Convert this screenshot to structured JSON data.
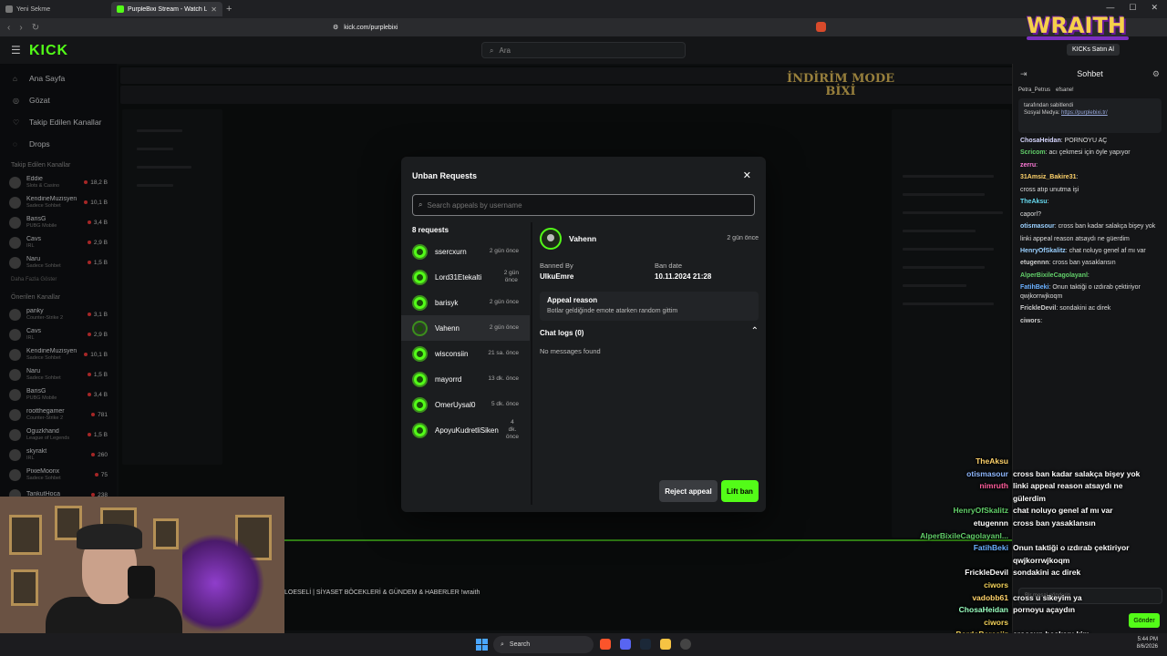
{
  "browser": {
    "tabs": [
      {
        "title": "Yeni Sekme",
        "active": false
      },
      {
        "title": "PurpleBixi Stream - Watch Live o",
        "active": true
      }
    ],
    "url": "kick.com/purplebixi"
  },
  "kick": {
    "logo": "KICK",
    "search_placeholder": "Ara",
    "kicks_button": "KICKs Satın Al",
    "nav": [
      {
        "label": "Ana Sayfa",
        "icon": "home-icon"
      },
      {
        "label": "Gözat",
        "icon": "compass-icon"
      },
      {
        "label": "Takip Edilen Kanallar",
        "icon": "heart-icon"
      },
      {
        "label": "Drops",
        "icon": "drops-icon"
      }
    ],
    "followed_title": "Takip Edilen Kanallar",
    "followed": [
      {
        "name": "Eddie",
        "cat": "Slots & Casino",
        "count": "18,2 B"
      },
      {
        "name": "KendineMuzisyen",
        "cat": "Sadece Sohbet",
        "count": "10,1 B"
      },
      {
        "name": "BarisG",
        "cat": "PUBG Mobile",
        "count": "3,4 B"
      },
      {
        "name": "Cavs",
        "cat": "IRL",
        "count": "2,9 B"
      },
      {
        "name": "Naru",
        "cat": "Sadece Sohbet",
        "count": "1,5 B"
      }
    ],
    "more_label": "Daha Fazla Göster",
    "recommended_title": "Önerilen Kanallar",
    "recommended": [
      {
        "name": "panky",
        "cat": "Counter-Strike 2",
        "count": "3,1 B"
      },
      {
        "name": "Cavs",
        "cat": "IRL",
        "count": "2,9 B"
      },
      {
        "name": "KendineMuzisyen",
        "cat": "Sadece Sohbet",
        "count": "10,1 B"
      },
      {
        "name": "Naru",
        "cat": "Sadece Sohbet",
        "count": "1,5 B"
      },
      {
        "name": "BarisG",
        "cat": "PUBG Mobile",
        "count": "3,4 B"
      },
      {
        "name": "rootthegamer",
        "cat": "Counter-Strike 2",
        "count": "781"
      },
      {
        "name": "Oguzkhand",
        "cat": "League of Legends",
        "count": "1,5 B"
      },
      {
        "name": "skyrakt",
        "cat": "IRL",
        "count": "260"
      },
      {
        "name": "PixieMoonx",
        "cat": "Sadece Sohbet",
        "count": "75"
      },
      {
        "name": "TankutHoca",
        "cat": "",
        "count": "238"
      }
    ]
  },
  "chat": {
    "title": "Sohbet",
    "gifts": [
      "Petra_Petrus",
      "efsane!"
    ],
    "pinned_line1": "tarafından sabitlendi",
    "pinned_line2": "Sosyal Medya:",
    "pinned_link": "https://purplebixi.tr/",
    "messages": [
      {
        "user": "ChosaHeidan",
        "text": "PORNOYU AÇ",
        "color": "#d7d7ff"
      },
      {
        "user": "Scricom",
        "text": "acı çekmesi için öyle yapıyor",
        "color": "#62d06a"
      },
      {
        "user": "zerru",
        "text": "",
        "color": "#ff7ad9"
      },
      {
        "user": "31Amsiz_Bakire31",
        "text": "",
        "color": "#ffd36b"
      },
      {
        "user": "",
        "text": "cross atıp unutma işi",
        "color": "#ff5e5e"
      },
      {
        "user": "TheAksu",
        "text": "",
        "color": "#66d9ef"
      },
      {
        "user": "",
        "text": "caporl?",
        "color": "#aaa"
      },
      {
        "user": "otismasour",
        "text": "cross ban kadar salakça bişey yok",
        "color": "#9ad0ff"
      },
      {
        "user": "",
        "text": "linki appeal reason atsaydı ne güerdim",
        "color": "#ff5e5e"
      },
      {
        "user": "HenryOfSkalitz",
        "text": "chat noluyo genel af mı var",
        "color": "#9ad0ff"
      },
      {
        "user": "etugennn",
        "text": "cross ban yasaklansın",
        "color": "#ccc"
      },
      {
        "user": "AlperBixileCagolayanl",
        "text": "",
        "color": "#62d06a"
      },
      {
        "user": "FatihBeki",
        "text": "Onun taktiği o ızdırab çektiriyor qwjkorrwjkoqm",
        "color": "#6ab0ff"
      },
      {
        "user": "FrickleDevil",
        "text": "sondakini ac direk",
        "color": "#ccc"
      },
      {
        "user": "ciwors",
        "text": "",
        "color": "#ccc"
      }
    ],
    "input_placeholder": "Bir mesaj gönderin",
    "send_label": "Gönder"
  },
  "overlay": {
    "banner": "İNDİRİM MODE BİXİ",
    "brand": "WRAITH",
    "stream_title": "LOESELİ | SİYASET BÖCEKLERİ & GÜNDEM & HABERLER !wraith",
    "chat": [
      {
        "user": "TheAksu",
        "text": "",
        "color": "#ffd36b"
      },
      {
        "user": "otismasour",
        "text": "cross ban kadar salakça bişey yok",
        "color": "#8fb8ff"
      },
      {
        "user": "nimruth",
        "text": "linki appeal reason atsaydı ne",
        "color": "#ff5e9c"
      },
      {
        "user": "",
        "text": "gülerdim",
        "color": "#fff"
      },
      {
        "user": "HenryOfSkalitz",
        "text": "chat noluyo genel af mı var",
        "color": "#62d06a"
      },
      {
        "user": "etugennn",
        "text": "cross ban yasaklansın",
        "color": "#ffffff"
      },
      {
        "user": "AlperBixileCagolayanl...",
        "text": "",
        "color": "#62d06a"
      },
      {
        "user": "FatihBeki",
        "text": "Onun taktiği o ızdırab çektiriyor",
        "color": "#6ab0ff"
      },
      {
        "user": "",
        "text": "qwjkorrwjkoqm",
        "color": "#fff"
      },
      {
        "user": "FrickleDevil",
        "text": "sondakini ac direk",
        "color": "#ffffff"
      },
      {
        "user": "ciwors",
        "text": "",
        "color": "#f2d25a"
      },
      {
        "user": "vadobb61",
        "text": "cross u sikeyim ya",
        "color": "#ffd36b"
      },
      {
        "user": "ChosaHeidan",
        "text": "pornoyu açaydın",
        "color": "#9affc0"
      },
      {
        "user": "ciwors",
        "text": "",
        "color": "#f2d25a"
      },
      {
        "user": "BordoBeresiiz",
        "text": "crossun başkanı kim",
        "color": "#f2d25a"
      }
    ]
  },
  "modal": {
    "title": "Unban Requests",
    "search_placeholder": "Search appeals by username",
    "count_label": "8 requests",
    "requests": [
      {
        "name": "ssercxurn",
        "time": "2 gün önce"
      },
      {
        "name": "Lord31Etekalti",
        "time": "2 gün\nönce"
      },
      {
        "name": "barisyk",
        "time": "2 gün önce"
      },
      {
        "name": "Vahenn",
        "time": "2 gün önce"
      },
      {
        "name": "wisconsiin",
        "time": "21 sa. önce"
      },
      {
        "name": "mayorrd",
        "time": "13 dk. önce"
      },
      {
        "name": "OmerUysal0",
        "time": "5 dk. önce"
      },
      {
        "name": "ApoyuKudretliSiken",
        "time": "4\ndk.\nönce"
      }
    ],
    "selected_index": 3,
    "detail": {
      "name": "Vahenn",
      "time": "2 gün önce",
      "banned_by_label": "Banned By",
      "banned_by": "UlkuEmre",
      "ban_date_label": "Ban date",
      "ban_date": "10.11.2024 21:28",
      "appeal_title": "Appeal reason",
      "appeal_text": "Botlar geldiğinde emote atarken random gittim",
      "logs_title": "Chat logs (0)",
      "logs_empty": "No messages found"
    },
    "reject_label": "Reject appeal",
    "lift_label": "Lift ban"
  },
  "taskbar": {
    "search_label": "Search",
    "time": "5:44 PM",
    "date": "8/6/2026"
  },
  "colors": {
    "kick_green": "#53fc18",
    "modal_bg": "#1b1d1f",
    "page_bg": "#131517"
  }
}
